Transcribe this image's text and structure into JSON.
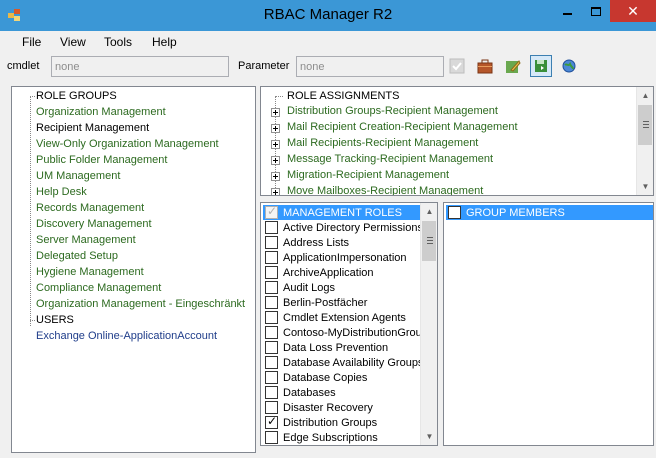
{
  "window": {
    "title": "RBAC Manager R2"
  },
  "menu": [
    "File",
    "View",
    "Tools",
    "Help"
  ],
  "toolbar": {
    "cmdlet_label": "cmdlet",
    "cmdlet_value": "none",
    "parameter_label": "Parameter",
    "parameter_value": "none"
  },
  "left_tree": {
    "role_groups_header": "ROLE GROUPS",
    "role_groups": [
      "Organization Management",
      "Recipient Management",
      "View-Only Organization Management",
      "Public Folder Management",
      "UM Management",
      "Help Desk",
      "Records Management",
      "Discovery Management",
      "Server Management",
      "Delegated Setup",
      "Hygiene Management",
      "Compliance Management",
      "Organization Management - Eingeschränkt"
    ],
    "users_header": "USERS",
    "users": [
      "Exchange Online-ApplicationAccount"
    ]
  },
  "role_assignments": {
    "header": "ROLE ASSIGNMENTS",
    "items": [
      "Distribution Groups-Recipient Management",
      "Mail Recipient Creation-Recipient Management",
      "Mail Recipients-Recipient Management",
      "Message Tracking-Recipient Management",
      "Migration-Recipient Management",
      "Move Mailboxes-Recipient Management"
    ]
  },
  "management_roles": {
    "header": "MANAGEMENT ROLES",
    "items": [
      {
        "label": "Active Directory Permissions",
        "checked": false
      },
      {
        "label": "Address Lists",
        "checked": false
      },
      {
        "label": "ApplicationImpersonation",
        "checked": false
      },
      {
        "label": "ArchiveApplication",
        "checked": false
      },
      {
        "label": "Audit Logs",
        "checked": false
      },
      {
        "label": "Berlin-Postfächer",
        "checked": false
      },
      {
        "label": "Cmdlet Extension Agents",
        "checked": false
      },
      {
        "label": "Contoso-MyDistributionGroup",
        "checked": false
      },
      {
        "label": "Data Loss Prevention",
        "checked": false
      },
      {
        "label": "Database Availability Groups",
        "checked": false
      },
      {
        "label": "Database Copies",
        "checked": false
      },
      {
        "label": "Databases",
        "checked": false
      },
      {
        "label": "Disaster Recovery",
        "checked": false
      },
      {
        "label": "Distribution Groups",
        "checked": true
      },
      {
        "label": "Edge Subscriptions",
        "checked": false
      }
    ]
  },
  "group_members": {
    "header": "GROUP MEMBERS"
  }
}
